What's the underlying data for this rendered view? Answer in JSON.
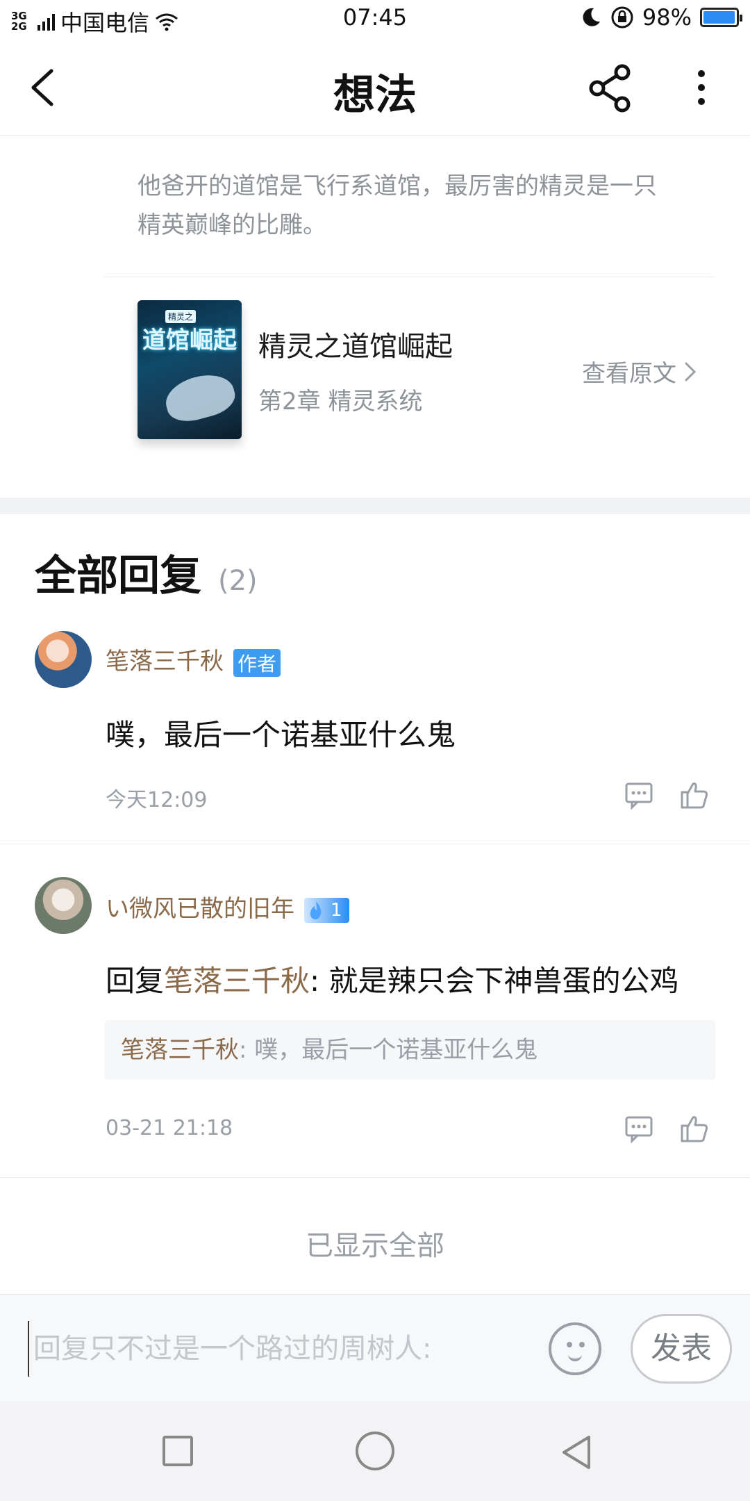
{
  "status_bar": {
    "network": "3G\n2G",
    "carrier": "中国电信",
    "time": "07:45",
    "battery": "98%",
    "battery_level": 0.98
  },
  "header": {
    "title": "想法",
    "back_icon": "chevron-left-icon",
    "share_icon": "share-icon",
    "more_icon": "more-vertical-icon"
  },
  "quote": {
    "text": "他爸开的道馆是飞行系道馆，最厉害的精灵是一只精英巅峰的比雕。"
  },
  "book": {
    "cover_title": "道馆崛起",
    "cover_tag": "精灵之",
    "name": "精灵之道馆崛起",
    "chapter": "第2章 精灵系统",
    "view_original": "查看原文"
  },
  "replies": {
    "title": "全部回复",
    "count": "(2)",
    "items": [
      {
        "user": "笔落三千秋",
        "badge": "作者",
        "text": "噗，最后一个诺基亚什么鬼",
        "time": "今天12:09"
      },
      {
        "user": "い微风已散的旧年",
        "badge": "1",
        "reply_prefix": "回复",
        "reply_to": "笔落三千秋",
        "text": ": 就是辣只会下神兽蛋的公鸡",
        "quote_user": "笔落三千秋",
        "quote_text": ": 噗，最后一个诺基亚什么鬼",
        "time": "03-21 21:18"
      }
    ],
    "all_shown": "已显示全部"
  },
  "compose": {
    "placeholder": "回复只不过是一个路过的周树人:",
    "send_label": "发表"
  },
  "colors": {
    "accent_blue": "#3d9bf0",
    "username_brown": "#8a6a4a",
    "muted_gray": "#9a9ea6"
  }
}
